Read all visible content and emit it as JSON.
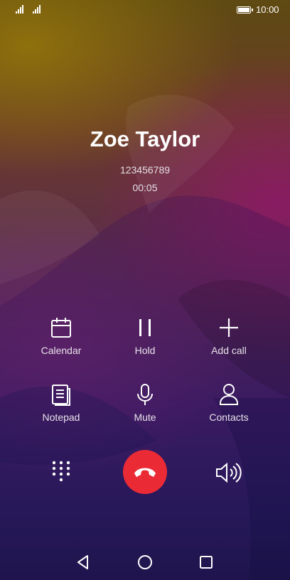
{
  "status_bar": {
    "time": "10:00"
  },
  "call": {
    "name": "Zoe Taylor",
    "number": "123456789",
    "duration": "00:05"
  },
  "controls": {
    "calendar": "Calendar",
    "hold": "Hold",
    "add_call": "Add call",
    "notepad": "Notepad",
    "mute": "Mute",
    "contacts": "Contacts"
  },
  "icons": [
    "signal-icon",
    "battery-icon",
    "calendar-icon",
    "pause-icon",
    "plus-icon",
    "notepad-icon",
    "microphone-icon",
    "person-icon",
    "dialpad-icon",
    "end-call-icon",
    "speaker-icon",
    "back-icon",
    "home-icon",
    "recent-apps-icon"
  ],
  "colors": {
    "end_call": "#ea2b36"
  }
}
